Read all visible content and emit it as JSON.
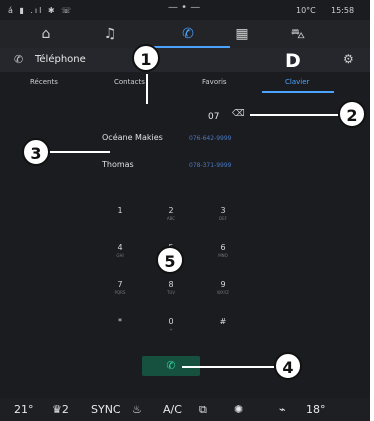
{
  "status": {
    "temperature": "10°C",
    "time": "15:58",
    "icons": "á ▮ .ıl ✱ ☏",
    "dots": "— • —"
  },
  "nav": {
    "items": [
      {
        "name": "home-icon",
        "glyph": "⌂"
      },
      {
        "name": "music-icon",
        "glyph": "♫"
      },
      {
        "name": "phone-icon",
        "glyph": "✆"
      },
      {
        "name": "apps-icon",
        "glyph": "▦"
      },
      {
        "name": "car-icon",
        "glyph": "⛍"
      }
    ]
  },
  "titlebar": {
    "title": "Téléphone",
    "phone_glyph": "✆",
    "gear_glyph": "⚙"
  },
  "tabs": {
    "recents": "Récents",
    "contacts": "Contacts",
    "favoris": "Favoris",
    "clavier": "Clavier"
  },
  "dialer": {
    "entry": "07",
    "backspace_glyph": "⌫"
  },
  "contacts": [
    {
      "name": "Océane Makies",
      "number": "076-642-9999"
    },
    {
      "name": "Thomas",
      "number": "078-371-9999"
    }
  ],
  "keypad": [
    {
      "main": "1",
      "sub": ""
    },
    {
      "main": "2",
      "sub": "ABC"
    },
    {
      "main": "3",
      "sub": "DEF"
    },
    {
      "main": "4",
      "sub": "GHI"
    },
    {
      "main": "5",
      "sub": "JKL"
    },
    {
      "main": "6",
      "sub": "MNO"
    },
    {
      "main": "7",
      "sub": "PQRS"
    },
    {
      "main": "8",
      "sub": "TUV"
    },
    {
      "main": "9",
      "sub": "WXYZ"
    },
    {
      "main": "*",
      "sub": ""
    },
    {
      "main": "0",
      "sub": "+"
    },
    {
      "main": "#",
      "sub": ""
    }
  ],
  "call_glyph": "✆",
  "bottombar": {
    "temp_left": "21°",
    "seat_left": "2",
    "sync": "SYNC",
    "seat_heat_glyph": "♨",
    "ac": "A/C",
    "defrost_glyph": "⧉",
    "fan_glyph": "✺",
    "vent_glyph": "⌁",
    "temp_right": "18°"
  },
  "callouts": {
    "c1": "1",
    "c2": "2",
    "c3": "3",
    "c4": "4",
    "c5": "5",
    "cD": "D"
  }
}
